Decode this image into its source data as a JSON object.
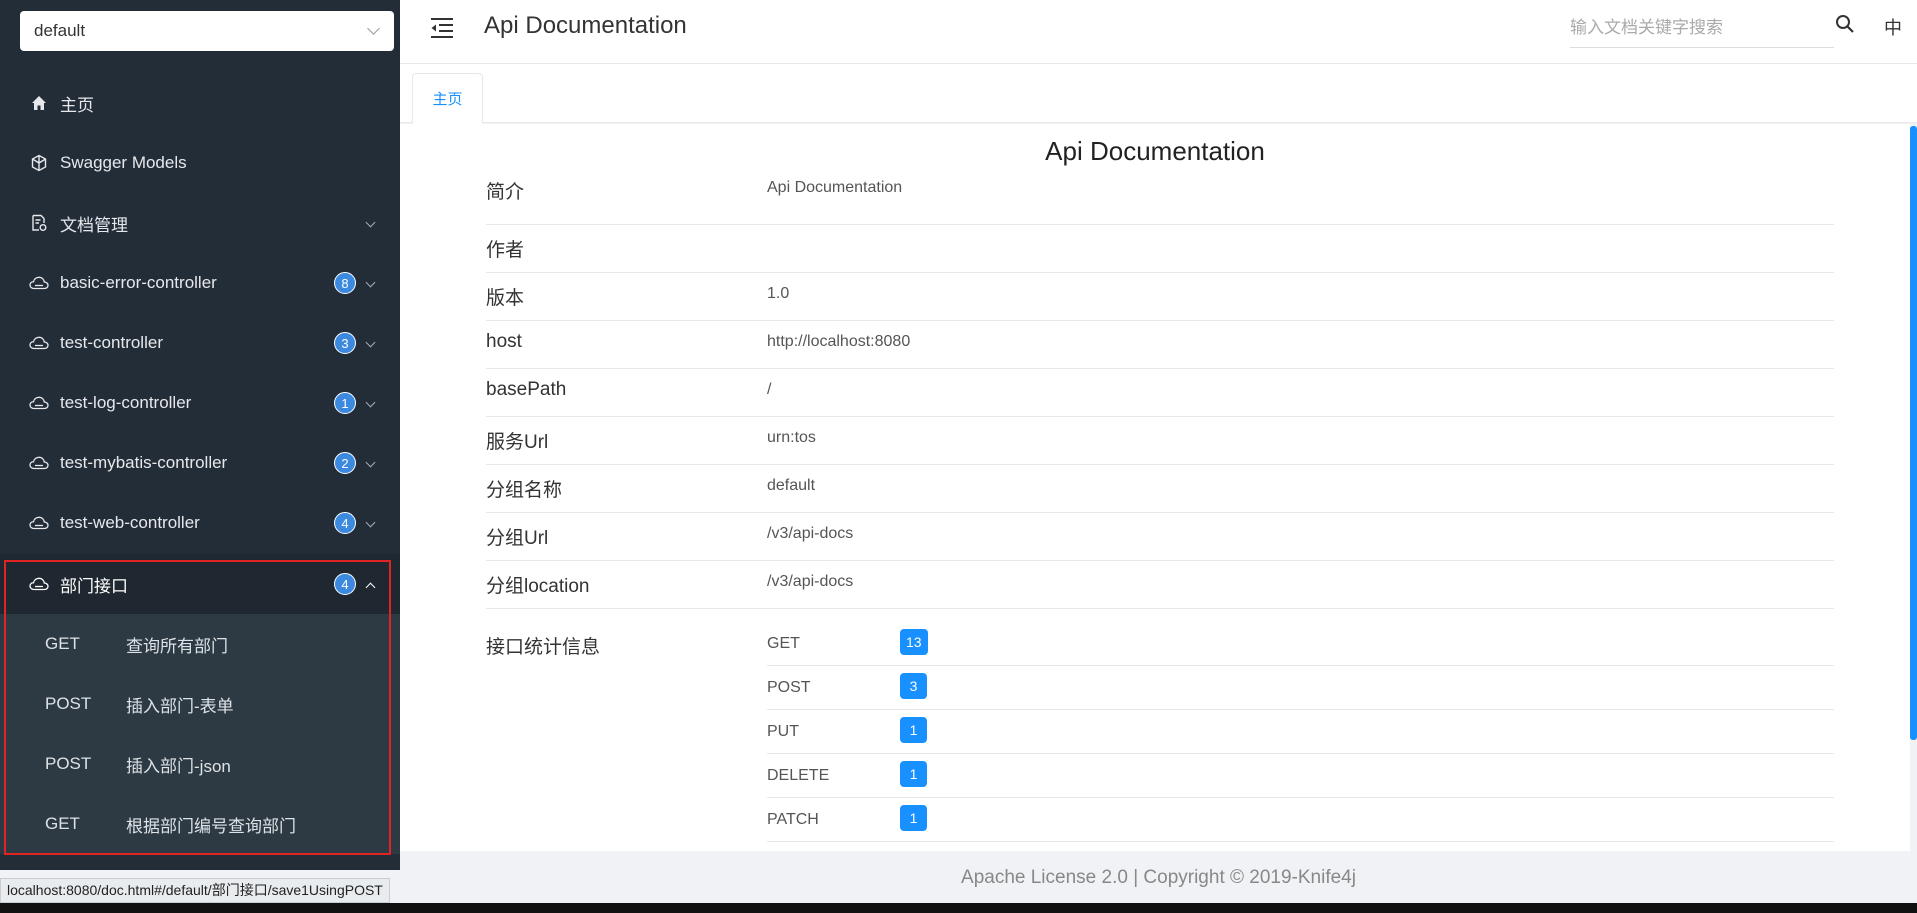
{
  "sidebar": {
    "group_select": "default",
    "items": [
      {
        "label": "主页",
        "icon": "home-icon"
      },
      {
        "label": "Swagger Models",
        "icon": "model-icon"
      },
      {
        "label": "文档管理",
        "icon": "document-manage-icon"
      },
      {
        "label": "basic-error-controller",
        "icon": "cloud-icon",
        "badge": "8"
      },
      {
        "label": "test-controller",
        "icon": "cloud-icon",
        "badge": "3"
      },
      {
        "label": "test-log-controller",
        "icon": "cloud-icon",
        "badge": "1"
      },
      {
        "label": "test-mybatis-controller",
        "icon": "cloud-icon",
        "badge": "2"
      },
      {
        "label": "test-web-controller",
        "icon": "cloud-icon",
        "badge": "4"
      },
      {
        "label": "部门接口",
        "icon": "cloud-icon",
        "badge": "4"
      }
    ],
    "submenu": [
      {
        "method": "GET",
        "label": "查询所有部门"
      },
      {
        "method": "POST",
        "label": "插入部门-表单"
      },
      {
        "method": "POST",
        "label": "插入部门-json"
      },
      {
        "method": "GET",
        "label": "根据部门编号查询部门"
      }
    ]
  },
  "header": {
    "title": "Api Documentation",
    "search_placeholder": "输入文档关键字搜索",
    "lang": "中"
  },
  "tabs": [
    {
      "label": "主页"
    }
  ],
  "doc": {
    "title": "Api Documentation",
    "rows": [
      {
        "key": "简介",
        "value": "Api Documentation"
      },
      {
        "key": "作者",
        "value": ""
      },
      {
        "key": "版本",
        "value": "1.0"
      },
      {
        "key": "host",
        "value": "http://localhost:8080"
      },
      {
        "key": "basePath",
        "value": "/"
      },
      {
        "key": "服务Url",
        "value": "urn:tos"
      },
      {
        "key": "分组名称",
        "value": "default"
      },
      {
        "key": "分组Url",
        "value": "/v3/api-docs"
      },
      {
        "key": "分组location",
        "value": "/v3/api-docs"
      }
    ],
    "stats_label": "接口统计信息",
    "stats": [
      {
        "method": "GET",
        "count": "13"
      },
      {
        "method": "POST",
        "count": "3"
      },
      {
        "method": "PUT",
        "count": "1"
      },
      {
        "method": "DELETE",
        "count": "1"
      },
      {
        "method": "PATCH",
        "count": "1"
      }
    ]
  },
  "footer": {
    "text": "Apache License 2.0 | Copyright © 2019-Knife4j"
  },
  "status_bar": {
    "url": "localhost:8080/doc.html#/default/部门接口/save1UsingPOST"
  },
  "colors": {
    "sidebar_bg": "#232d38",
    "submenu_bg": "#2d3a43",
    "accent": "#1890ff",
    "highlight_border": "#e02424"
  }
}
